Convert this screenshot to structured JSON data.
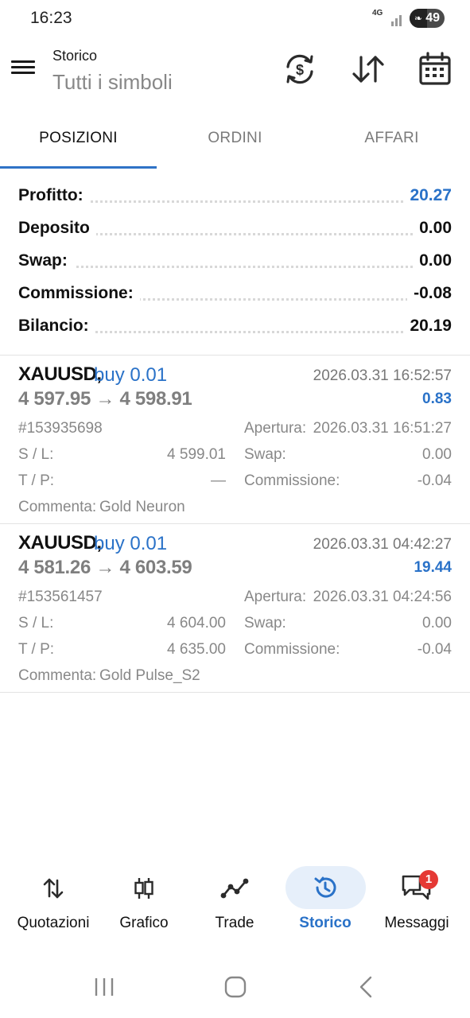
{
  "status_bar": {
    "time": "16:23",
    "network": "4G",
    "battery": "49"
  },
  "header": {
    "title": "Storico",
    "subtitle": "Tutti i simboli",
    "icons": [
      "currency-exchange-icon",
      "sort-arrows-icon",
      "calendar-icon"
    ]
  },
  "tabs": [
    {
      "label": "POSIZIONI",
      "active": true
    },
    {
      "label": "ORDINI",
      "active": false
    },
    {
      "label": "AFFARI",
      "active": false
    }
  ],
  "summary": [
    {
      "label": "Profitto:",
      "value": "20.27"
    },
    {
      "label": "Deposito",
      "value": "0.00"
    },
    {
      "label": "Swap:",
      "value": "0.00"
    },
    {
      "label": "Commissione:",
      "value": "-0.08"
    },
    {
      "label": "Bilancio:",
      "value": "20.19"
    }
  ],
  "positions": [
    {
      "symbol": "XAUUSD,",
      "side": "buy 0.01",
      "close_time": "2026.03.31 16:52:57",
      "prices": "4 597.95 → 4 598.91",
      "profit": "0.83",
      "ticket": "#153935698",
      "open_label": "Apertura:",
      "open_time": "2026.03.31 16:51:27",
      "sl_label": "S / L:",
      "sl": "4 599.01",
      "swap_label": "Swap:",
      "swap": "0.00",
      "tp_label": "T / P:",
      "tp": "—",
      "commission_label": "Commissione:",
      "commission": "-0.04",
      "comment_label": "Commenta:",
      "comment": "Gold Neuron"
    },
    {
      "symbol": "XAUUSD,",
      "side": "buy 0.01",
      "close_time": "2026.03.31 04:42:27",
      "prices": "4 581.26 → 4 603.59",
      "profit": "19.44",
      "ticket": "#153561457",
      "open_label": "Apertura:",
      "open_time": "2026.03.31 04:24:56",
      "sl_label": "S / L:",
      "sl": "4 604.00",
      "swap_label": "Swap:",
      "swap": "0.00",
      "tp_label": "T / P:",
      "tp": "4 635.00",
      "commission_label": "Commissione:",
      "commission": "-0.04",
      "comment_label": "Commenta:",
      "comment": "Gold Pulse_S2"
    }
  ],
  "bottom_nav": [
    {
      "label": "Quotazioni",
      "icon": "quotes-arrows-icon",
      "active": false
    },
    {
      "label": "Grafico",
      "icon": "candlestick-chart-icon",
      "active": false
    },
    {
      "label": "Trade",
      "icon": "trade-line-icon",
      "active": false
    },
    {
      "label": "Storico",
      "icon": "history-clock-icon",
      "active": true
    },
    {
      "label": "Messaggi",
      "icon": "messages-icon",
      "active": false,
      "badge": "1"
    }
  ],
  "colors": {
    "accent": "#2a72c8",
    "badge": "#e53935",
    "active_pill": "#e6effa"
  }
}
